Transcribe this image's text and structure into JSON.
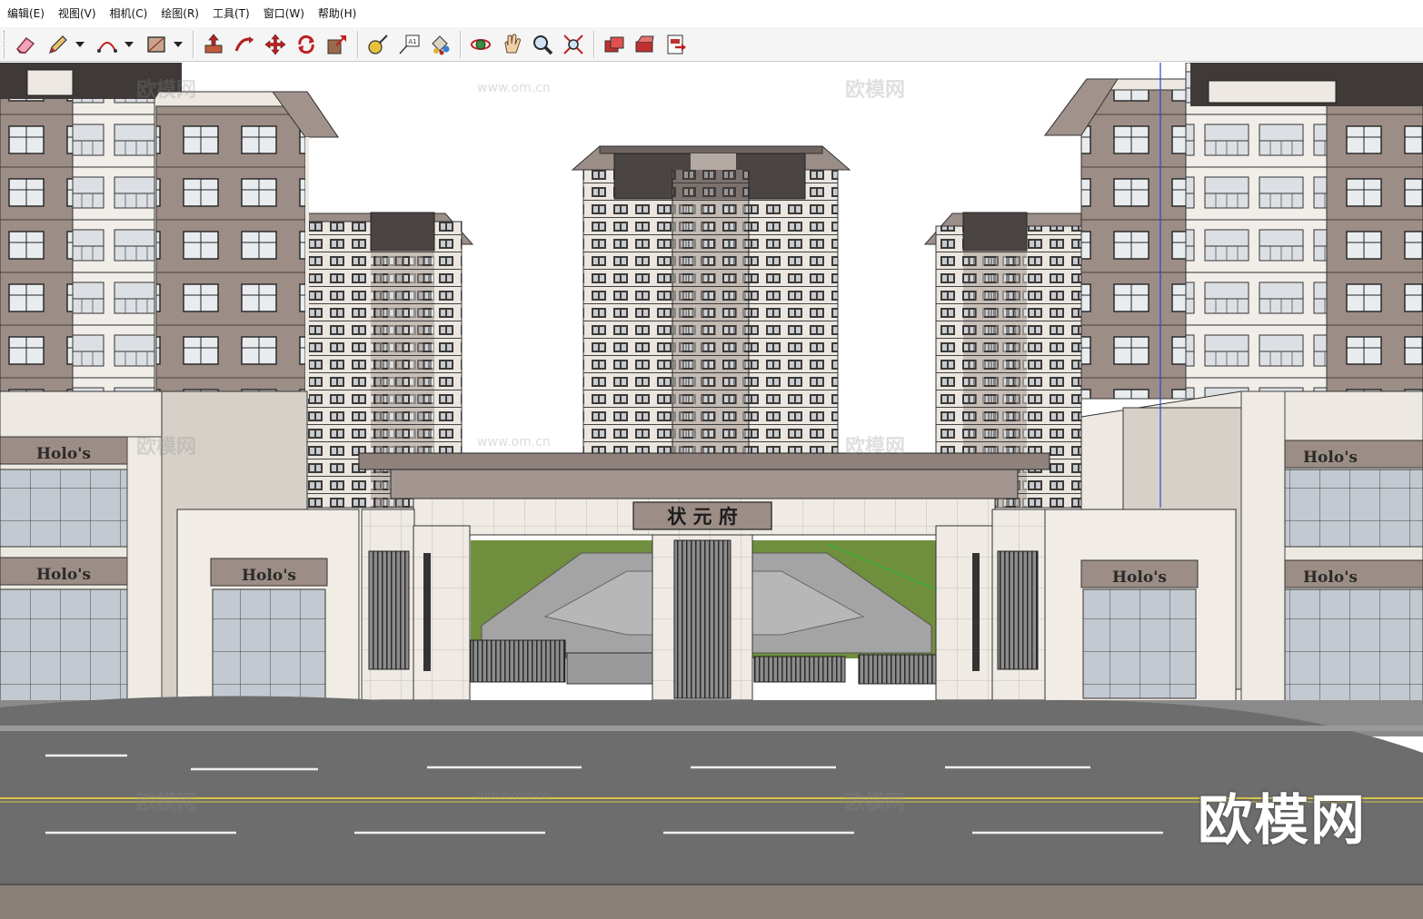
{
  "menu": {
    "items": [
      "编辑(E)",
      "视图(V)",
      "相机(C)",
      "绘图(R)",
      "工具(T)",
      "窗口(W)",
      "帮助(H)"
    ]
  },
  "toolbar": {
    "tools": [
      {
        "icon": "eraser-icon"
      },
      {
        "icon": "pencil-icon",
        "dropdown": true
      },
      {
        "icon": "arc-icon",
        "dropdown": true
      },
      {
        "icon": "rectangle-icon",
        "dropdown": true
      },
      {
        "icon": "push-pull-icon"
      },
      {
        "icon": "follow-me-icon"
      },
      {
        "icon": "move-icon"
      },
      {
        "icon": "rotate-icon"
      },
      {
        "icon": "scale-icon"
      },
      {
        "icon": "tape-measure-icon"
      },
      {
        "icon": "text-label-icon"
      },
      {
        "icon": "paint-bucket-icon"
      },
      {
        "icon": "orbit-icon"
      },
      {
        "icon": "pan-icon"
      },
      {
        "icon": "zoom-icon"
      },
      {
        "icon": "zoom-extents-icon"
      },
      {
        "icon": "warehouse-icon"
      },
      {
        "icon": "extension-warehouse-icon"
      },
      {
        "icon": "send-to-layout-icon"
      }
    ]
  },
  "scene": {
    "gate_sign": "状 元 府",
    "shop_sign": "Holo's",
    "watermark_big": "欧模网",
    "watermark_faint": "欧模网",
    "watermark_url": "www.om.cn",
    "colors": {
      "facade_brown": "#9c8d86",
      "facade_light": "#ede9e2",
      "window_blue": "#b8c0c9",
      "road": "#6d6d6d",
      "lawn": "#6f8e3e",
      "sky": "#ffffff",
      "axis_green": "#29b829",
      "axis_blue": "#2848d0"
    }
  }
}
